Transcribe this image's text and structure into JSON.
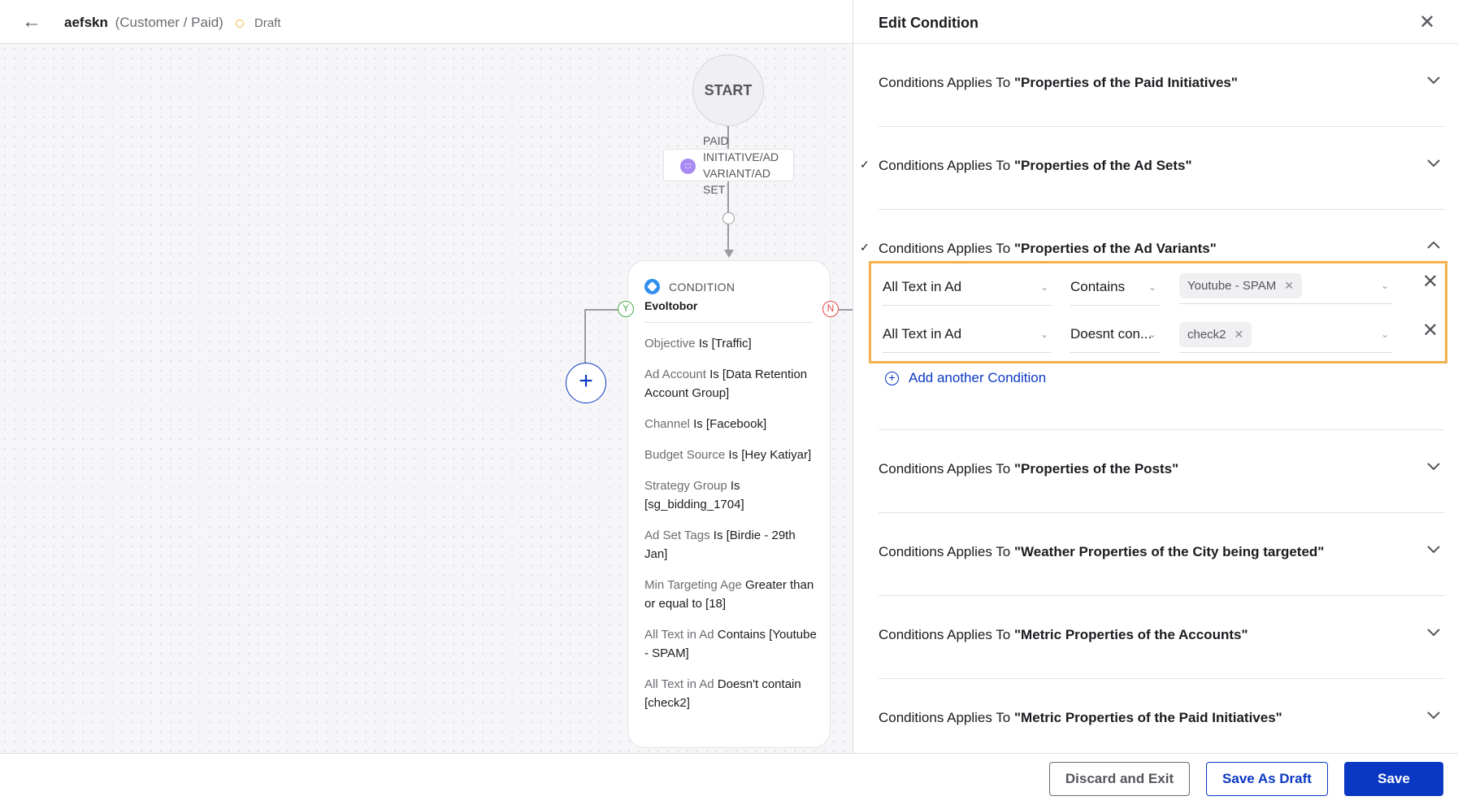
{
  "header": {
    "title": "aefskn",
    "subtitle": "(Customer / Paid)",
    "status": "Draft",
    "status_color": "#f1b440"
  },
  "flow": {
    "start_label": "START",
    "trigger_label": "PAID INITIATIVE/AD VARIANT/AD SET",
    "condition": {
      "type_label": "CONDITION",
      "name": "Evoltobor",
      "yes_label": "Y",
      "no_label": "N",
      "rules": [
        {
          "key": "Objective",
          "value": "Is [Traffic]"
        },
        {
          "key": "Ad Account",
          "value": "Is [Data Retention Account Group]"
        },
        {
          "key": "Channel",
          "value": "Is [Facebook]"
        },
        {
          "key": "Budget Source",
          "value": "Is [Hey Katiyar]"
        },
        {
          "key": "Strategy Group",
          "value": "Is [sg_bidding_1704]"
        },
        {
          "key": "Ad Set Tags",
          "value": "Is [Birdie - 29th Jan]"
        },
        {
          "key": "Min Targeting Age",
          "value": "Greater than or equal to [18]"
        },
        {
          "key": "All Text in Ad",
          "value": "Contains [Youtube - SPAM]"
        },
        {
          "key": "All Text in Ad",
          "value": "Doesn't contain [check2]"
        }
      ]
    }
  },
  "panel": {
    "title": "Edit Condition",
    "sections": [
      {
        "prefix": "Conditions Applies To ",
        "target": "\"Properties of the Paid Initiatives\"",
        "checked": false,
        "expanded": false
      },
      {
        "prefix": "Conditions Applies To ",
        "target": "\"Properties of the Ad Sets\"",
        "checked": true,
        "expanded": false
      },
      {
        "prefix": "Conditions Applies To ",
        "target": "\"Properties of the Ad Variants\"",
        "checked": true,
        "expanded": true
      },
      {
        "prefix": "Conditions Applies To ",
        "target": "\"Properties of the Posts\"",
        "checked": false,
        "expanded": false
      },
      {
        "prefix": "Conditions Applies To ",
        "target": "\"Weather Properties of the City being targeted\"",
        "checked": false,
        "expanded": false
      },
      {
        "prefix": "Conditions Applies To ",
        "target": "\"Metric Properties of the Accounts\"",
        "checked": false,
        "expanded": false
      },
      {
        "prefix": "Conditions Applies To ",
        "target": "\"Metric Properties of the Paid Initiatives\"",
        "checked": false,
        "expanded": false
      }
    ],
    "check_glyph": "✓",
    "condition_rows": [
      {
        "field": "All Text in Ad",
        "operator": "Contains",
        "values": [
          "Youtube - SPAM"
        ]
      },
      {
        "field": "All Text in Ad",
        "operator": "Doesnt con...",
        "values": [
          "check2"
        ]
      }
    ],
    "add_condition_label": "Add another Condition",
    "highlight_color": "#f2b04e"
  },
  "footer": {
    "discard_label": "Discard and Exit",
    "draft_label": "Save As Draft",
    "save_label": "Save",
    "primary_color": "#0a38c2"
  }
}
